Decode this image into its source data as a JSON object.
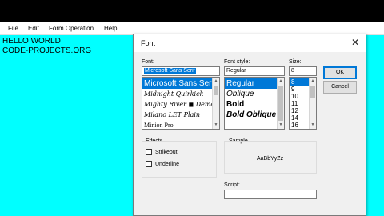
{
  "menu": [
    "File",
    "Edit",
    "Form Operation",
    "Help"
  ],
  "client": {
    "lines": [
      "HELLO WORLD",
      "CODE-PROJECTS.ORG"
    ],
    "background": "#00ffff"
  },
  "dialog": {
    "title": "Font",
    "font": {
      "label": "Font:",
      "value": "Microsoft Sans Serif",
      "items": [
        "Microsoft Sans Serif",
        "Midnight Quirkick",
        "Mighty River ◼ Demo",
        "Milano LET Plain",
        "Minion Pro"
      ],
      "selected_index": 0
    },
    "style": {
      "label": "Font style:",
      "value": "Regular",
      "items": [
        "Regular",
        "Oblique",
        "Bold",
        "Bold Oblique"
      ],
      "selected_index": 0
    },
    "size": {
      "label": "Size:",
      "value": "8",
      "items": [
        "8",
        "9",
        "10",
        "11",
        "12",
        "14",
        "16"
      ],
      "selected_index": 0
    },
    "buttons": {
      "ok": "OK",
      "cancel": "Cancel"
    },
    "effects": {
      "label": "Effects",
      "strikeout": {
        "label": "Strikeout",
        "checked": false
      },
      "underline": {
        "label": "Underline",
        "checked": false
      }
    },
    "sample": {
      "label": "Sample",
      "text": "AaBbYyZz"
    },
    "script": {
      "label": "Script:"
    }
  },
  "colors": {
    "accent": "#0078d7",
    "client": "#00ffff",
    "dialog": "#f0f0f0"
  }
}
